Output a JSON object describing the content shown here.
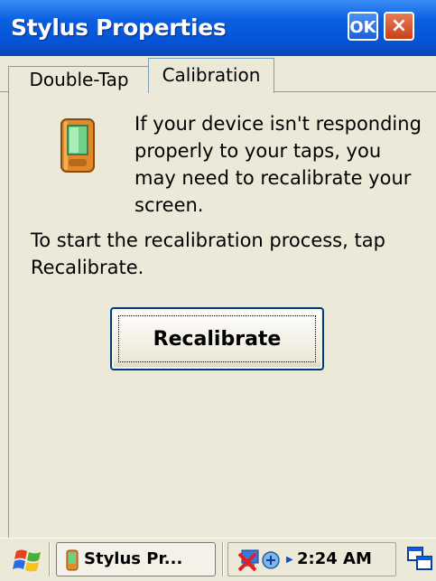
{
  "window": {
    "title": "Stylus Properties",
    "ok_label": "OK",
    "close_label": "×"
  },
  "tabs": [
    {
      "label": "Double-Tap",
      "active": false
    },
    {
      "label": "Calibration",
      "active": true
    }
  ],
  "calibration": {
    "icon": "pocket-pc-device-icon",
    "info_text": "If your device isn't responding properly to your taps, you may need to recalibrate your screen.",
    "instructions": "To start the recalibration process, tap Recalibrate.",
    "recalibrate_label": "Recalibrate"
  },
  "taskbar": {
    "start_icon": "windows-flag-icon",
    "task_label": "Stylus Pr...",
    "task_icon": "pocket-pc-device-icon",
    "tray_icons": [
      "network-disconnected-icon",
      "connection-icon"
    ],
    "time": "2:24 AM",
    "desktop_icon": "switch-windows-icon"
  },
  "colors": {
    "title_bar": "#0653d6",
    "face": "#ece9d8",
    "close_button": "#c8421b",
    "button_border": "#003c74"
  }
}
